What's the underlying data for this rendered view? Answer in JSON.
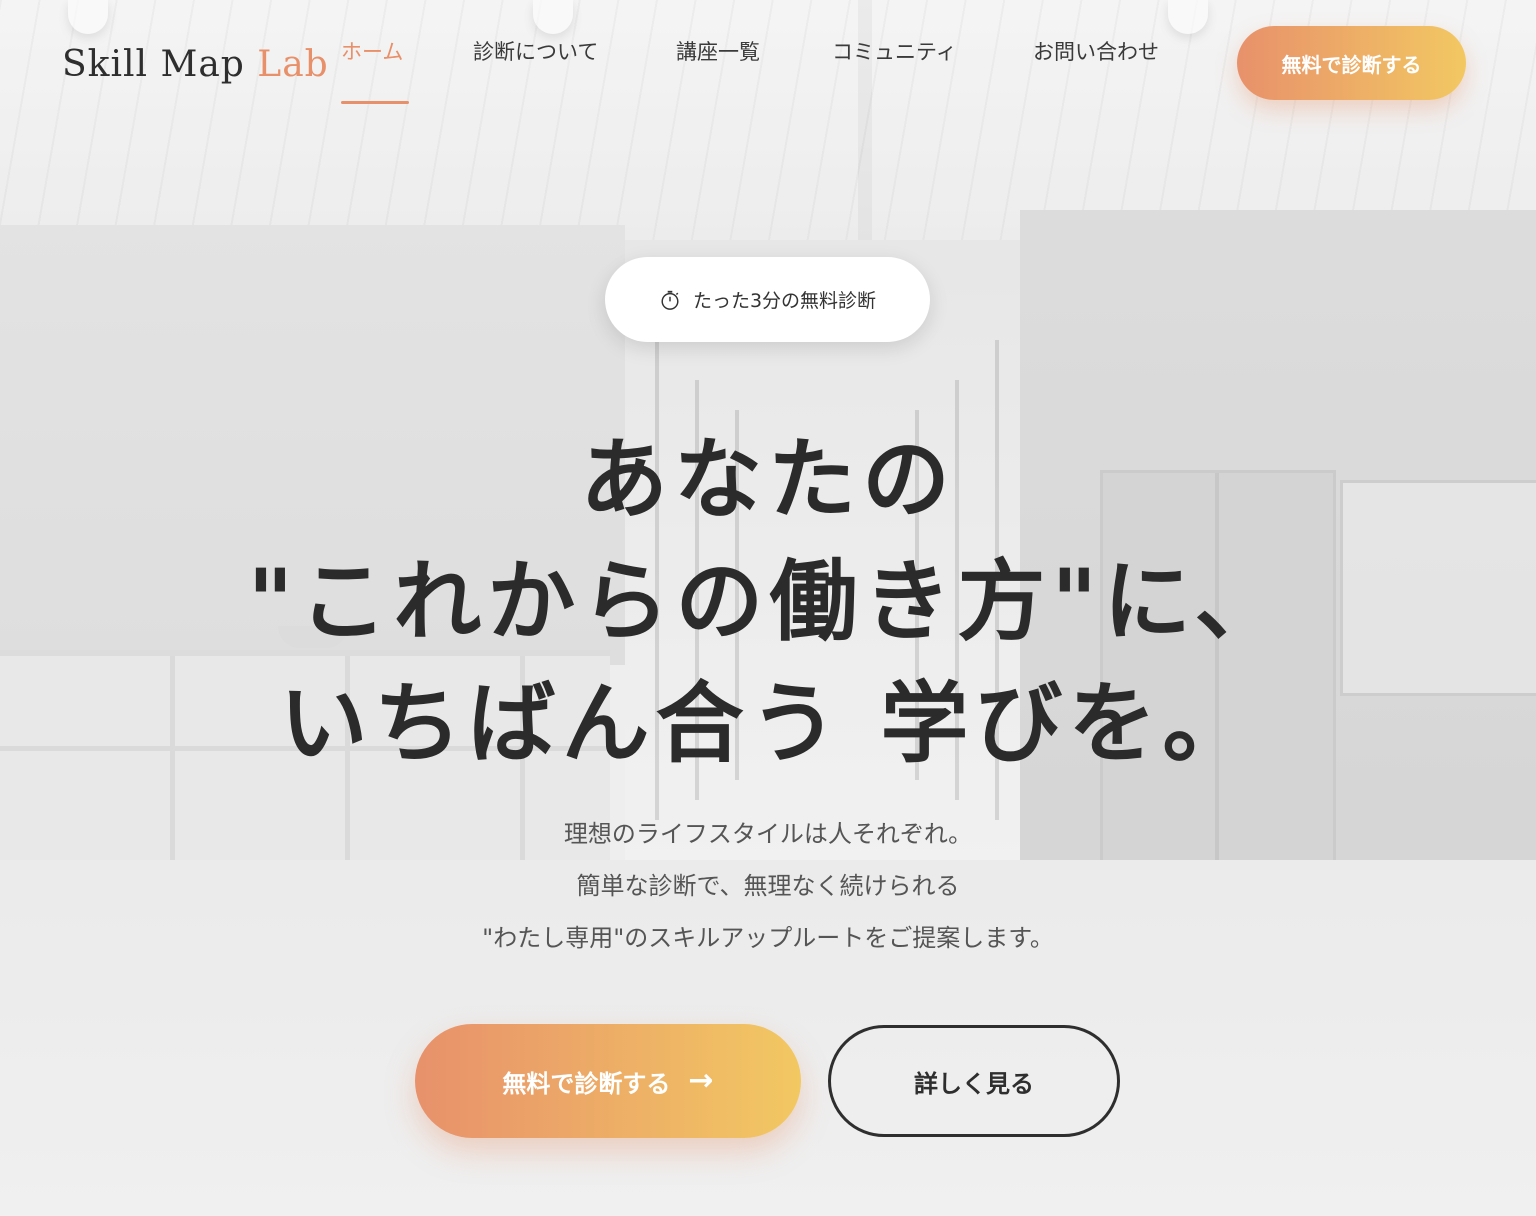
{
  "header": {
    "logo_main": "Skill Map ",
    "logo_accent": "Lab",
    "nav": [
      {
        "label": "ホーム",
        "active": true
      },
      {
        "label": "診断について",
        "active": false
      },
      {
        "label": "講座一覧",
        "active": false
      },
      {
        "label": "コミュニティ",
        "active": false
      },
      {
        "label": "お問い合わせ",
        "active": false
      }
    ],
    "cta_label": "無料で診断する"
  },
  "hero": {
    "badge_icon": "stopwatch-icon",
    "badge_text": "たった3分の無料診断",
    "headline_line1": "あなたの",
    "headline_line2": "\"これからの働き方\"に、",
    "headline_line3_before": "いちばん合う",
    "headline_line3_mark": "学び",
    "headline_line3_after": "を。",
    "sub_lines": [
      "理想のライフスタイルは人それぞれ。",
      "簡単な診断で、無理なく続けられる",
      "\"わたし専用\"のスキルアップルートをご提案します。"
    ],
    "primary_cta": "無料で診断する",
    "primary_cta_icon": "arrow-right-icon",
    "secondary_cta": "詳しく見る"
  },
  "colors": {
    "accent": "#e8906a",
    "gradient_start": "#e8916b",
    "gradient_end": "#f2c862",
    "text": "#2e2e2e"
  }
}
